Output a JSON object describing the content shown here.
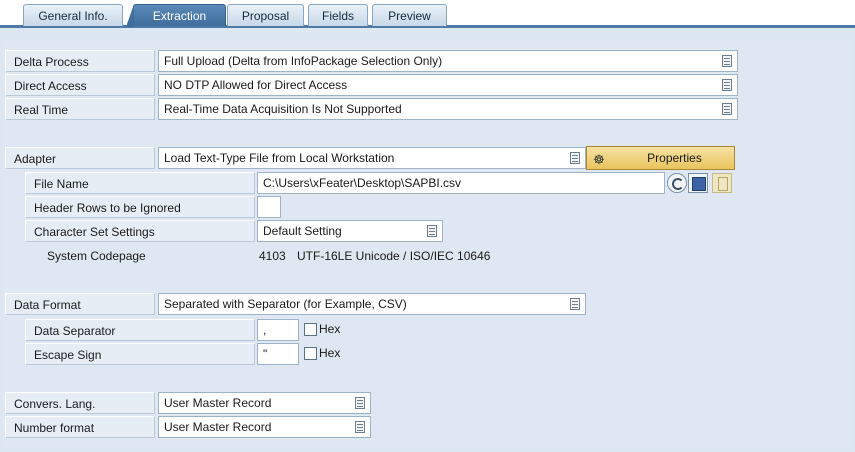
{
  "tabs": [
    {
      "label": "General Info."
    },
    {
      "label": "Extraction"
    },
    {
      "label": "Proposal"
    },
    {
      "label": "Fields"
    },
    {
      "label": "Preview"
    }
  ],
  "delta_process": {
    "label": "Delta Process",
    "value": "Full Upload (Delta from InfoPackage Selection Only)"
  },
  "direct_access": {
    "label": "Direct Access",
    "value": "NO DTP Allowed for Direct Access"
  },
  "real_time": {
    "label": "Real Time",
    "value": "Real-Time Data Acquisition Is Not Supported"
  },
  "adapter": {
    "label": "Adapter",
    "value": "Load Text-Type File from Local Workstation",
    "properties_label": "Properties"
  },
  "file_name": {
    "label": "File Name",
    "value": "C:\\Users\\xFeater\\Desktop\\SAPBI.csv"
  },
  "header_rows": {
    "label": "Header Rows to be Ignored",
    "value": ""
  },
  "charset": {
    "label": "Character Set Settings",
    "value": "Default Setting"
  },
  "codepage": {
    "label": "System Codepage",
    "code": "4103",
    "value": "UTF-16LE Unicode / ISO/IEC 10646"
  },
  "data_format": {
    "label": "Data Format",
    "value": "Separated with Separator (for Example, CSV)"
  },
  "data_separator": {
    "label": "Data Separator",
    "value": ",",
    "hex_label": "Hex"
  },
  "escape_sign": {
    "label": "Escape Sign",
    "value": "\"",
    "hex_label": "Hex"
  },
  "convers_lang": {
    "label": "Convers. Lang.",
    "value": "User Master Record"
  },
  "number_format": {
    "label": "Number format",
    "value": "User Master Record"
  }
}
